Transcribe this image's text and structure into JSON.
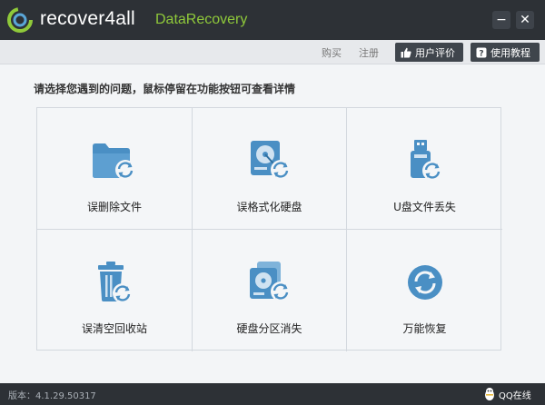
{
  "titlebar": {
    "brand": "recover4all",
    "product": "DataRecovery",
    "minimize_symbol": "−",
    "close_symbol": "✕"
  },
  "toolbar": {
    "buy": "购买",
    "register": "注册",
    "review": "用户评价",
    "guide": "使用教程"
  },
  "instruction": "请选择您遇到的问题，鼠标停留在功能按钮可查看详情",
  "options": [
    {
      "label": "误删除文件",
      "icon": "folder-recover-icon"
    },
    {
      "label": "误格式化硬盘",
      "icon": "disk-format-icon"
    },
    {
      "label": "U盘文件丢失",
      "icon": "usb-drive-icon"
    },
    {
      "label": "误清空回收站",
      "icon": "recycle-bin-icon"
    },
    {
      "label": "硬盘分区消失",
      "icon": "disk-partition-icon"
    },
    {
      "label": "万能恢复",
      "icon": "universal-recover-icon"
    }
  ],
  "statusbar": {
    "version": "版本：4.1.29.50317",
    "qq": "QQ在线"
  },
  "colors": {
    "titlebar": "#2d3136",
    "accent_green": "#8fc93a",
    "icon_blue": "#4a8fc4"
  }
}
